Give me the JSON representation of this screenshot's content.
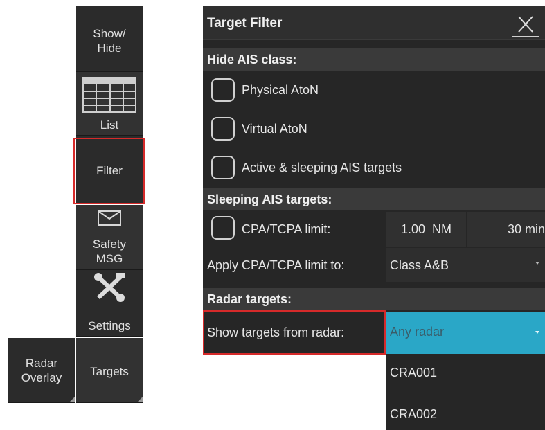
{
  "toolbar": {
    "show_hide": "Show/\nHide",
    "list": "List",
    "filter": "Filter",
    "safety_msg": "Safety\nMSG",
    "settings": "Settings",
    "radar_overlay": "Radar\nOverlay",
    "targets": "Targets"
  },
  "panel": {
    "title": "Target Filter",
    "hide_ais_header": "Hide AIS class:",
    "options": [
      "Physical AtoN",
      "Virtual AtoN",
      "Active & sleeping AIS targets"
    ],
    "sleeping_header": "Sleeping AIS targets:",
    "cpa_label": "CPA/TCPA limit:",
    "cpa_value": "1.00  NM",
    "tcpa_value": "30 min",
    "apply_label": "Apply CPA/TCPA limit to:",
    "apply_value": "Class A&B",
    "radar_header": "Radar targets:",
    "show_from_label": "Show targets from radar:",
    "show_from_value": "Any radar",
    "dropdown_options": [
      "CRA001",
      "CRA002"
    ]
  },
  "colors": {
    "panel_bg": "#262626",
    "section_bg": "#3a3a3a",
    "selected_dropdown": "#2aa7c7",
    "highlight_box": "#d62a2a"
  },
  "icons": [
    "list-grid-icon",
    "envelope-icon",
    "wrench-screwdriver-icon",
    "close-icon",
    "dropdown-caret-icon"
  ]
}
